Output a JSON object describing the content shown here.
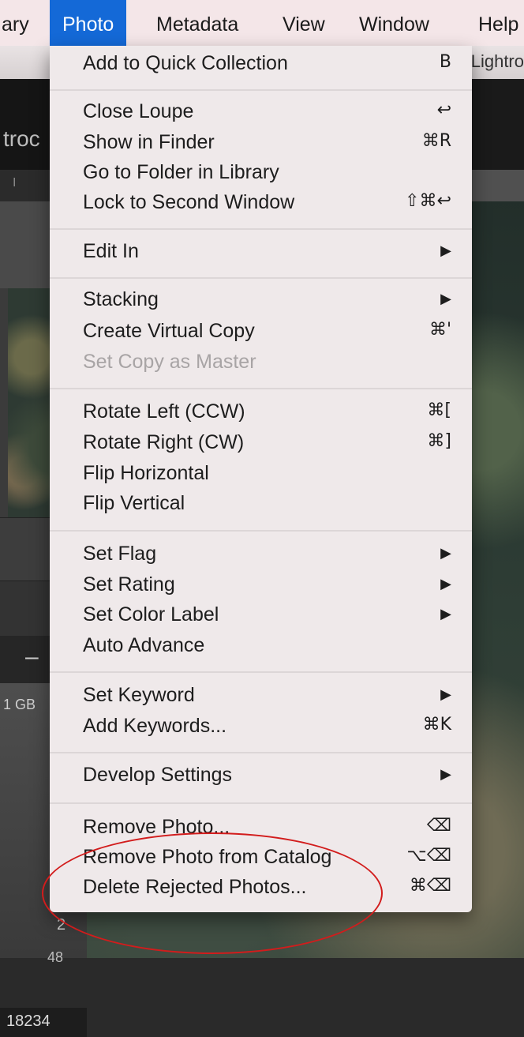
{
  "menubar": {
    "items": [
      {
        "label": "ary",
        "active": false
      },
      {
        "label": "Photo",
        "active": true
      },
      {
        "label": "Metadata",
        "active": false
      },
      {
        "label": "View",
        "active": false
      },
      {
        "label": "Window",
        "active": false
      },
      {
        "label": "Help",
        "active": false
      }
    ]
  },
  "window": {
    "title": "Lightro"
  },
  "background_app": {
    "brand_text": "troc",
    "strip_text": "I",
    "minus": "–",
    "storage_text": "1 GB",
    "histogram_value_1": "2",
    "histogram_value_2": "48",
    "photo_count": "18234"
  },
  "photo_menu": {
    "items": [
      {
        "label": "Add to Quick Collection",
        "shortcut": "B"
      },
      {
        "label": "Close Loupe",
        "shortcut": "↩"
      },
      {
        "label": "Show in Finder",
        "shortcut": "⌘R"
      },
      {
        "label": "Go to Folder in Library",
        "shortcut": ""
      },
      {
        "label": "Lock to Second Window",
        "shortcut": "⇧⌘↩"
      },
      {
        "label": "Edit In",
        "shortcut": "▶"
      },
      {
        "label": "Stacking",
        "shortcut": "▶"
      },
      {
        "label": "Create Virtual Copy",
        "shortcut": "⌘'"
      },
      {
        "label": "Set Copy as Master",
        "shortcut": "",
        "disabled": true
      },
      {
        "label": "Rotate Left (CCW)",
        "shortcut": "⌘["
      },
      {
        "label": "Rotate Right (CW)",
        "shortcut": "⌘]"
      },
      {
        "label": "Flip Horizontal",
        "shortcut": ""
      },
      {
        "label": "Flip Vertical",
        "shortcut": ""
      },
      {
        "label": "Set Flag",
        "shortcut": "▶"
      },
      {
        "label": "Set Rating",
        "shortcut": "▶"
      },
      {
        "label": "Set Color Label",
        "shortcut": "▶"
      },
      {
        "label": "Auto Advance",
        "shortcut": ""
      },
      {
        "label": "Set Keyword",
        "shortcut": "▶"
      },
      {
        "label": "Add Keywords...",
        "shortcut": "⌘K"
      },
      {
        "label": "Develop Settings",
        "shortcut": "▶"
      },
      {
        "label": "Remove Photo...",
        "shortcut": "⌫"
      },
      {
        "label": "Remove Photo from Catalog",
        "shortcut": "⌥⌫"
      },
      {
        "label": "Delete Rejected Photos...",
        "shortcut": "⌘⌫"
      }
    ]
  },
  "colors": {
    "menu_highlight": "#1469d7",
    "annotation": "#d21c1c"
  }
}
